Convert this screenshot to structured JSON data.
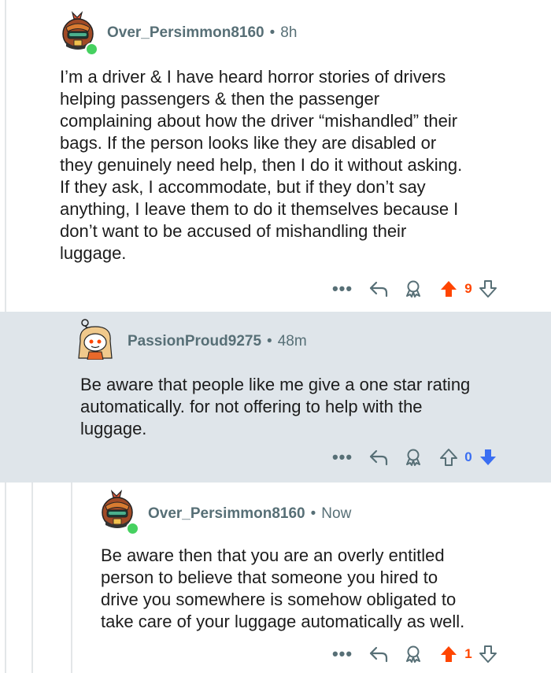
{
  "comments": [
    {
      "username": "Over_Persimmon8160",
      "separator": "•",
      "time": "8h",
      "online": true,
      "body_lines": [
        "I’m a driver & I have heard horror stories of drivers",
        "helping passengers & then the passenger",
        "complaining about how the driver “mishandled” their",
        "bags. If the person looks like they are disabled or",
        "they genuinely need help, then I do it without asking.",
        "If they ask, I accommodate, but if they don’t say",
        "anything, I leave them to do it themselves because I",
        "don’t want to be accused of mishandling their",
        "luggage."
      ],
      "more_label": "•••",
      "score": "9",
      "vote_state": "upvoted"
    },
    {
      "username": "PassionProud9275",
      "separator": "•",
      "time": "48m",
      "online": false,
      "body_lines": [
        "Be aware that people like me give a one star rating",
        "automatically. for not offering to help with the",
        "luggage."
      ],
      "more_label": "•••",
      "score": "0",
      "vote_state": "downvoted"
    },
    {
      "username": "Over_Persimmon8160",
      "separator": "•",
      "time": "Now",
      "online": true,
      "body_lines": [
        "Be aware then that you are an overly entitled",
        "person to believe that someone you hired to",
        "drive you somewhere is somehow obligated to",
        "take care of your luggage automatically as well."
      ],
      "more_label": "•••",
      "score": "1",
      "vote_state": "upvoted"
    }
  ],
  "colors": {
    "upvote": "#ff4500",
    "downvote": "#3a6ef2",
    "highlight_bg": "#dfe5ea",
    "meta_text": "#576f76",
    "online": "#46d160"
  },
  "icons": [
    "snoo-avatar-helmet",
    "snoo-avatar-blonde",
    "reply-icon",
    "award-icon",
    "upvote-arrow-icon",
    "downvote-arrow-icon",
    "more-options-icon"
  ]
}
